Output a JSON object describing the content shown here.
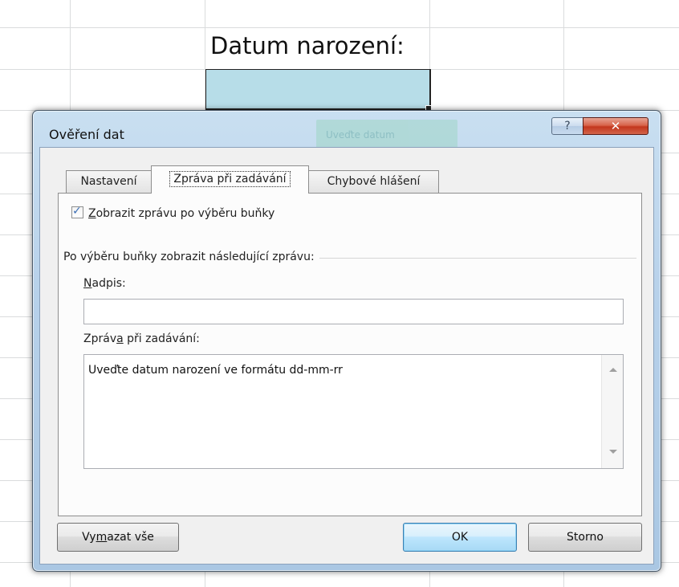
{
  "sheet": {
    "cell_label": "Datum narození:",
    "tooltip_ghost_text": "Uveďte datum"
  },
  "dialog": {
    "title": "Ověření dat",
    "help_glyph": "?",
    "close_glyph": "✕",
    "tabs": [
      {
        "label": "Nastavení",
        "active": false
      },
      {
        "label": "Zpráva při zadávání",
        "active": true
      },
      {
        "label": "Chybové hlášení",
        "active": false
      }
    ],
    "show_message_checkbox": {
      "checked": true,
      "label": "Zobrazit zprávu po výběru buňky",
      "accelerator": "Z"
    },
    "group_label": "Po výběru buňky zobrazit následující zprávu:",
    "title_field": {
      "label": "Nadpis:",
      "accelerator": "N",
      "value": ""
    },
    "message_field": {
      "label": "Zpráva při zadávání:",
      "accelerator": "a",
      "value": "Uveďte datum narození ve formátu dd-mm-rr"
    },
    "buttons": {
      "clear_all": "Vymazat vše",
      "clear_all_accelerator": "m",
      "ok": "OK",
      "cancel": "Storno"
    }
  },
  "colors": {
    "input_cell_fill": "#b7dde8",
    "close_button": "#c3361d",
    "checkmark": "#3c6fb5"
  }
}
